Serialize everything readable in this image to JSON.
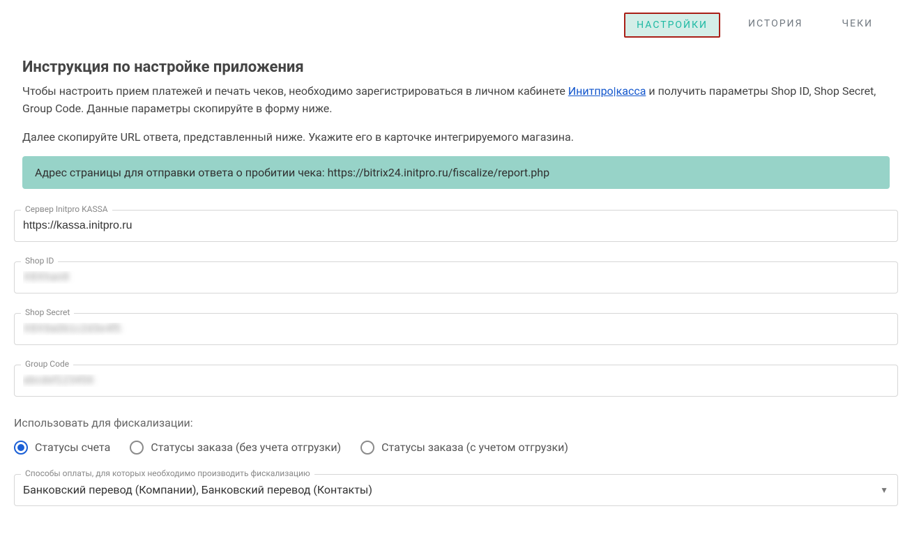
{
  "tabs": {
    "settings": "НАСТРОЙКИ",
    "history": "ИСТОРИЯ",
    "receipts": "ЧЕКИ"
  },
  "title": "Инструкция по настройке приложения",
  "intro_before": "Чтобы настроить прием платежей и печать чеков, необходимо зарегистрироваться в личном кабинете ",
  "intro_link": "Инитпро|касса",
  "intro_after": " и получить параметры Shop ID, Shop Secret, Group Code. Данные параметры скопируйте в форму ниже.",
  "intro2": "Далее скопируйте URL ответа, представленный ниже. Укажите его в карточке интегрируемого магазина.",
  "callout": "Адрес страницы для отправки ответа о пробитии чека: https://bitrix24.initpro.ru/fiscalize/report.php",
  "fields": {
    "server": {
      "label": "Сервер Initpro KASSA",
      "value": "https://kassa.initpro.ru"
    },
    "shop_id": {
      "label": "Shop ID",
      "value": "X8Xhan8"
    },
    "shop_secret": {
      "label": "Shop Secret",
      "value": "X8X9a0b1c2d3e4f5"
    },
    "group_code": {
      "label": "Group Code",
      "value": "abcdef123456"
    }
  },
  "fiscal_label": "Использовать для фискализации:",
  "radios": {
    "r1": "Статусы счета",
    "r2": "Статусы заказа (без учета отгрузки)",
    "r3": "Статусы заказа (с учетом отгрузки)"
  },
  "payment_select": {
    "label": "Способы оплаты, для которых необходимо производить фискализацию",
    "value": "Банковский перевод (Компании), Банковский перевод (Контакты)"
  }
}
